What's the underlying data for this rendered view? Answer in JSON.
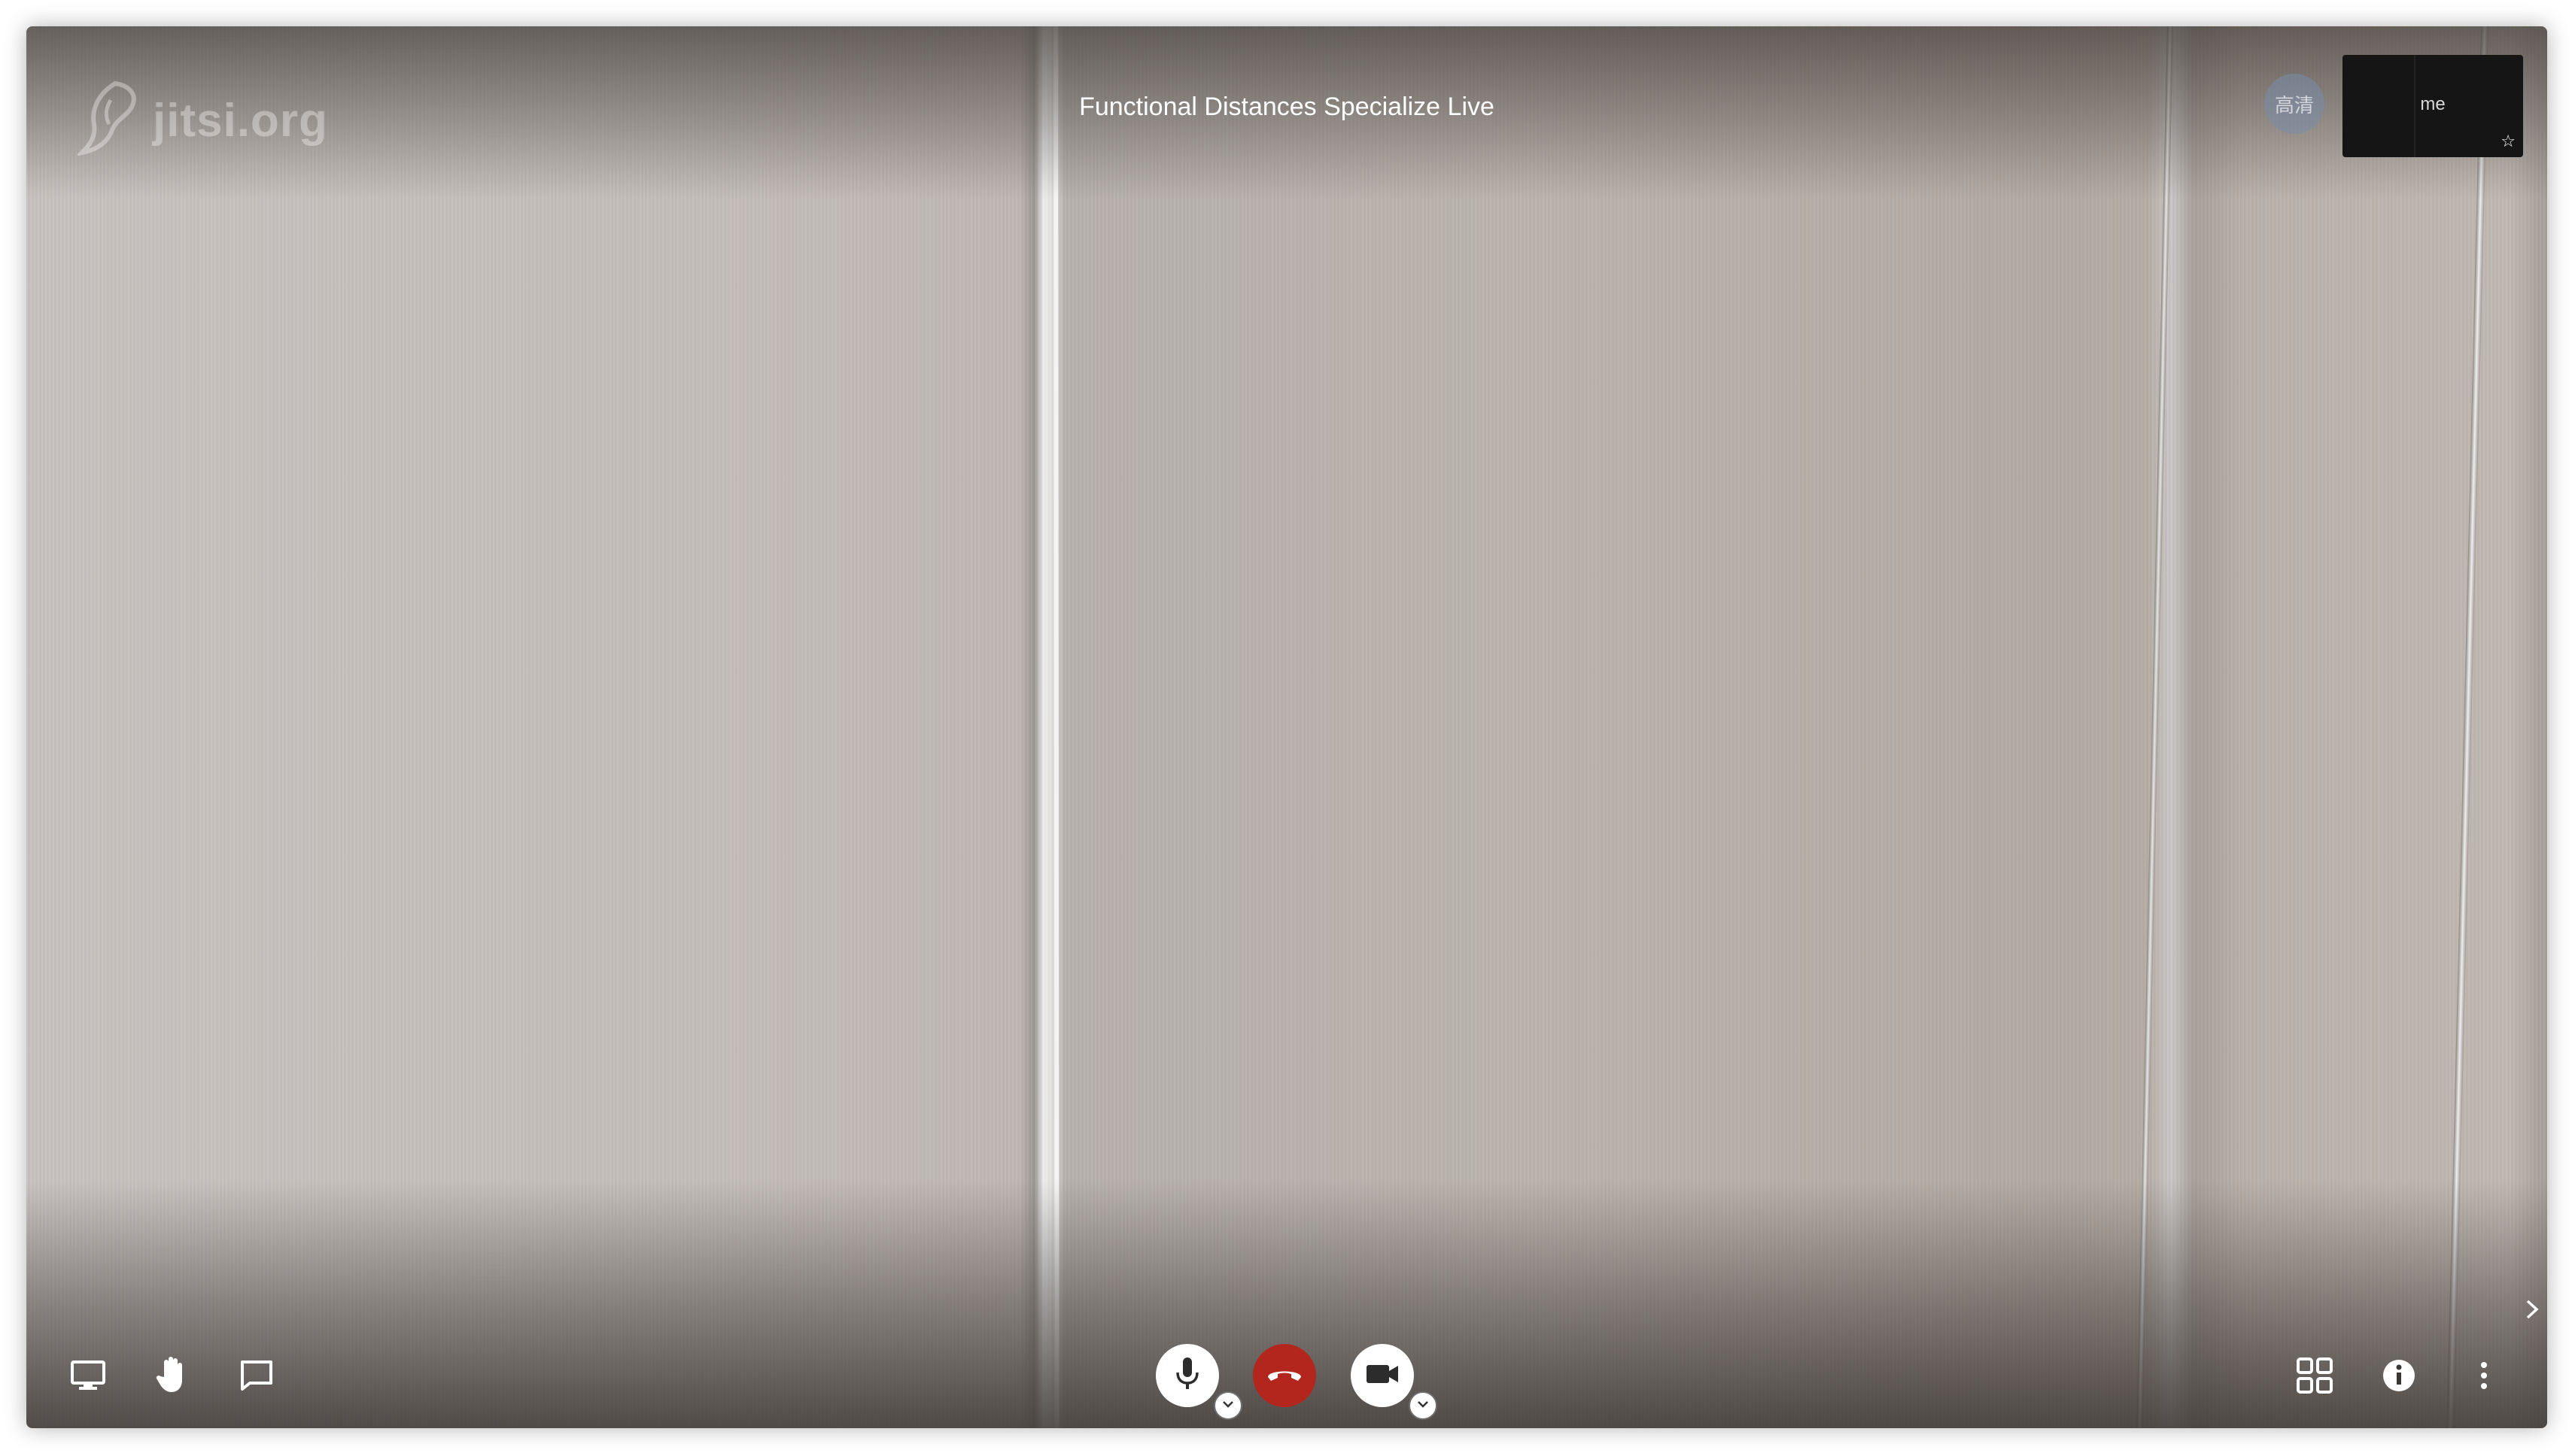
{
  "meeting": {
    "title": "Functional Distances Specialize Live",
    "watermark_text": "jitsi.org"
  },
  "participants": {
    "remote_avatar_initials": "高清",
    "self_label": "me"
  },
  "toolbar": {
    "left": [
      {
        "name": "share-screen-button",
        "icon": "monitor-icon"
      },
      {
        "name": "raise-hand-button",
        "icon": "hand-icon"
      },
      {
        "name": "chat-button",
        "icon": "chat-bubble-icon"
      }
    ],
    "center": [
      {
        "name": "microphone-button",
        "icon": "microphone-icon"
      },
      {
        "name": "hangup-button",
        "icon": "phone-hangup-icon",
        "color": "#b3261e"
      },
      {
        "name": "camera-button",
        "icon": "video-camera-icon"
      }
    ],
    "right": [
      {
        "name": "tile-view-button",
        "icon": "grid-icon"
      },
      {
        "name": "info-button",
        "icon": "info-icon"
      },
      {
        "name": "more-options-button",
        "icon": "more-vertical-icon"
      }
    ]
  },
  "colors": {
    "hangup": "#b3261e",
    "toolbar_icon": "#ffffff",
    "self_tile_bg": "#151515"
  }
}
